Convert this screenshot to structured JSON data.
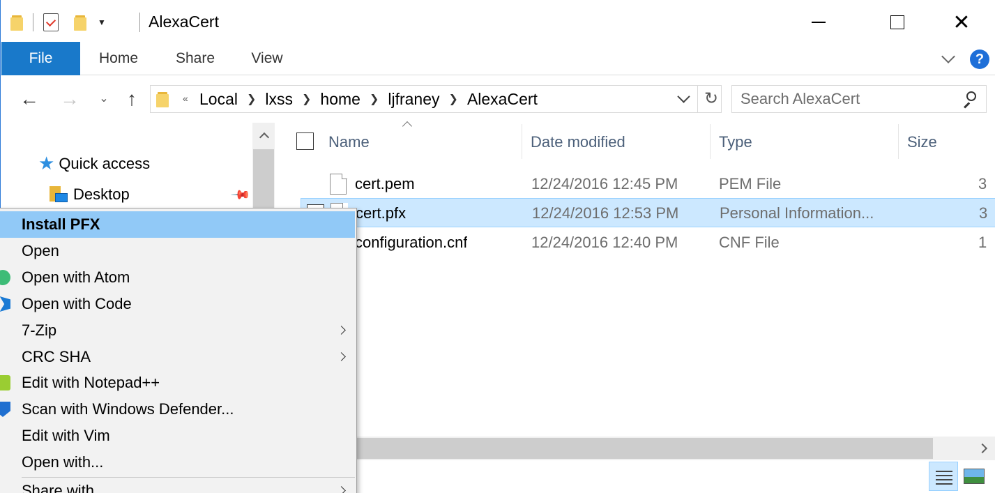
{
  "window": {
    "title": "AlexaCert",
    "minimize_label": "",
    "close_glyph": "✕"
  },
  "ribbon": {
    "tabs": [
      "File",
      "Home",
      "Share",
      "View"
    ],
    "help": "?"
  },
  "address": {
    "lead": "«",
    "crumbs": [
      "Local",
      "lxss",
      "home",
      "ljfraney",
      "AlexaCert"
    ],
    "search_placeholder": "Search AlexaCert"
  },
  "nav": {
    "back": "←",
    "forward": "→",
    "recent": "⌄",
    "up": "↑",
    "refresh": "↻"
  },
  "navpane": {
    "quick_access": "Quick access",
    "desktop": "Desktop"
  },
  "columns": {
    "name": "Name",
    "date": "Date modified",
    "type": "Type",
    "size": "Size"
  },
  "files": [
    {
      "name": "cert.pem",
      "date": "12/24/2016 12:45 PM",
      "type": "PEM File",
      "size": "3",
      "selected": false
    },
    {
      "name": "cert.pfx",
      "date": "12/24/2016 12:53 PM",
      "type": "Personal Information...",
      "size": "3",
      "selected": true
    },
    {
      "name": "configuration.cnf",
      "date": "12/24/2016 12:40 PM",
      "type": "CNF File",
      "size": "1",
      "selected": false
    }
  ],
  "context_menu": {
    "items": [
      {
        "label": "Install PFX",
        "icon": "",
        "submenu": false
      },
      {
        "label": "Open",
        "icon": "",
        "submenu": false
      },
      {
        "label": "Open with Atom",
        "icon": "atom-icon",
        "submenu": false
      },
      {
        "label": "Open with Code",
        "icon": "vscode-icon",
        "submenu": false
      },
      {
        "label": "7-Zip",
        "icon": "",
        "submenu": true
      },
      {
        "label": "CRC SHA",
        "icon": "",
        "submenu": true
      },
      {
        "label": "Edit with Notepad++",
        "icon": "notepadpp-icon",
        "submenu": false
      },
      {
        "label": "Scan with Windows Defender...",
        "icon": "defender-icon",
        "submenu": false
      },
      {
        "label": "Edit with Vim",
        "icon": "",
        "submenu": false
      },
      {
        "label": "Open with...",
        "icon": "",
        "submenu": false
      },
      {
        "label": "Share with",
        "icon": "",
        "submenu": true
      }
    ]
  },
  "colors": {
    "accent": "#1979ca",
    "selection": "#cce8ff",
    "menu_highlight": "#91c9f7"
  }
}
